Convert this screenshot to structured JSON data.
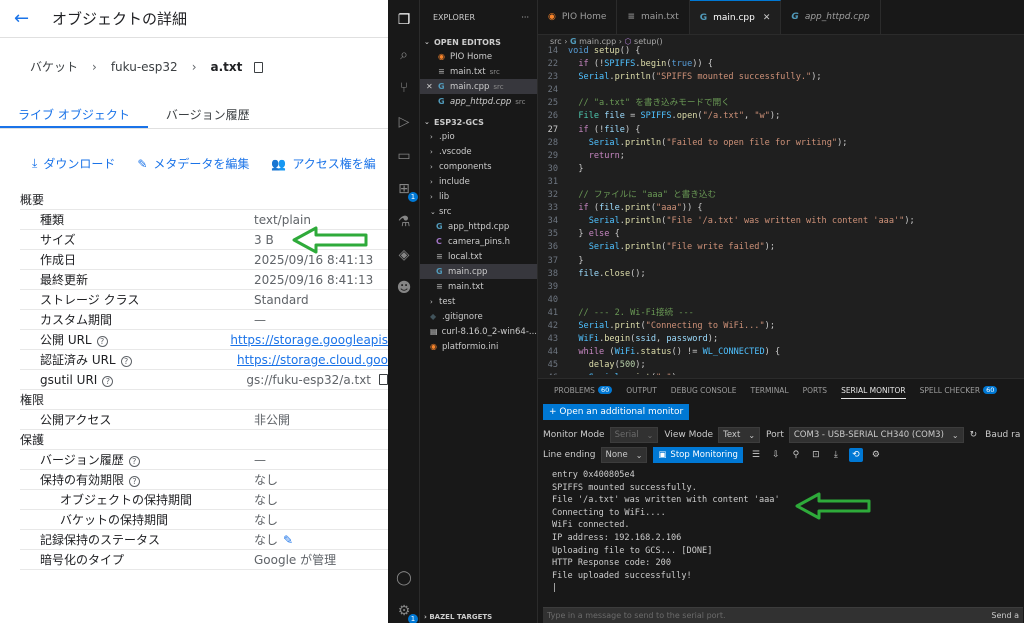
{
  "gcs": {
    "title": "オブジェクトの詳細",
    "breadcrumb": {
      "root": "バケット",
      "bucket": "fuku-esp32",
      "object": "a.txt"
    },
    "tabs": [
      {
        "label": "ライブ オブジェクト"
      },
      {
        "label": "バージョン履歴"
      }
    ],
    "actions": {
      "download": "ダウンロード",
      "edit_metadata": "メタデータを編集",
      "access": "アクセス権を編"
    },
    "sections": {
      "overview": "概要",
      "permissions": "権限",
      "protection": "保護"
    },
    "fields": {
      "type": {
        "k": "種類",
        "v": "text/plain"
      },
      "size": {
        "k": "サイズ",
        "v": "3 B"
      },
      "created": {
        "k": "作成日",
        "v": "2025/09/16 8:41:13"
      },
      "updated": {
        "k": "最終更新",
        "v": "2025/09/16 8:41:13"
      },
      "storage_class": {
        "k": "ストレージ クラス",
        "v": "Standard"
      },
      "custom_time": {
        "k": "カスタム期間",
        "v": "—"
      },
      "public_url": {
        "k": "公開 URL",
        "v": "https://storage.googleapis"
      },
      "auth_url": {
        "k": "認証済み URL",
        "v": "https://storage.cloud.goo"
      },
      "gsutil_uri": {
        "k": "gsutil URI",
        "v": "gs://fuku-esp32/a.txt"
      },
      "public_access": {
        "k": "公開アクセス",
        "v": "非公開"
      },
      "version_history": {
        "k": "バージョン履歴",
        "v": "—"
      },
      "retention": {
        "k": "保持の有効期限",
        "v": "なし"
      },
      "object_retention": {
        "k": "オブジェクトの保持期間",
        "v": "なし"
      },
      "bucket_retention": {
        "k": "バケットの保持期間",
        "v": "なし"
      },
      "hold_status": {
        "k": "記録保持のステータス",
        "v": "なし"
      },
      "encryption": {
        "k": "暗号化のタイプ",
        "v": "Google が管理"
      }
    }
  },
  "vscode": {
    "activity_badge": "1",
    "explorer": {
      "title": "EXPLORER",
      "more": "···",
      "open_editors_title": "OPEN EDITORS",
      "open_editors": [
        {
          "name": "PIO Home",
          "icon": "pio",
          "tag": ""
        },
        {
          "name": "main.txt",
          "icon": "txt",
          "tag": "src"
        },
        {
          "name": "main.cpp",
          "icon": "cpp",
          "tag": "src"
        },
        {
          "name": "app_httpd.cpp",
          "icon": "cpp",
          "tag": "src"
        }
      ],
      "project_title": "ESP32-GCS",
      "tree": [
        {
          "name": ".pio",
          "kind": "folder"
        },
        {
          "name": ".vscode",
          "kind": "folder"
        },
        {
          "name": "components",
          "kind": "folder"
        },
        {
          "name": "include",
          "kind": "folder"
        },
        {
          "name": "lib",
          "kind": "folder"
        },
        {
          "name": "src",
          "kind": "folder-open"
        },
        {
          "name": "app_httpd.cpp",
          "kind": "cpp"
        },
        {
          "name": "camera_pins.h",
          "kind": "h"
        },
        {
          "name": "local.txt",
          "kind": "txt"
        },
        {
          "name": "main.cpp",
          "kind": "cpp"
        },
        {
          "name": "main.txt",
          "kind": "txt"
        },
        {
          "name": "test",
          "kind": "folder"
        },
        {
          "name": ".gitignore",
          "kind": "git"
        },
        {
          "name": "curl-8.16.0_2-win64-...",
          "kind": "zip"
        },
        {
          "name": "platformio.ini",
          "kind": "pio"
        }
      ],
      "bazel": "BAZEL TARGETS"
    },
    "tabs": [
      {
        "name": "PIO Home",
        "icon": "pio"
      },
      {
        "name": "main.txt",
        "icon": "txt"
      },
      {
        "name": "main.cpp",
        "icon": "cpp"
      },
      {
        "name": "app_httpd.cpp",
        "icon": "cpp"
      }
    ],
    "breadcrumb": {
      "folder": "src",
      "file": "main.cpp",
      "symbol": "setup()"
    },
    "panel": {
      "tabs": [
        {
          "label": "PROBLEMS",
          "badge": "60"
        },
        {
          "label": "OUTPUT",
          "badge": ""
        },
        {
          "label": "DEBUG CONSOLE",
          "badge": ""
        },
        {
          "label": "TERMINAL",
          "badge": ""
        },
        {
          "label": "PORTS",
          "badge": ""
        },
        {
          "label": "SERIAL MONITOR",
          "badge": ""
        },
        {
          "label": "SPELL CHECKER",
          "badge": "60"
        }
      ],
      "add_monitor": "+ Open an additional monitor",
      "monitor_mode_label": "Monitor Mode",
      "monitor_mode_value": "Serial",
      "view_mode_label": "View Mode",
      "view_mode_value": "Text",
      "port_label": "Port",
      "port_value": "COM3 - USB-SERIAL CH340 (COM3)",
      "baud_label": "Baud ra",
      "line_ending_label": "Line ending",
      "line_ending_value": "None",
      "stop_button": "Stop Monitoring",
      "output_lines": [
        "entry 0x400805e4",
        "SPIFFS mounted successfully.",
        "File '/a.txt' was written with content 'aaa'",
        "Connecting to WiFi....",
        "WiFi connected.",
        "IP address: 192.168.2.106",
        "Uploading file to GCS... [DONE]",
        "HTTP Response code: 200",
        "File uploaded successfully!"
      ],
      "input_placeholder": "Type in a message to send to the serial port.",
      "send_label": "Send a"
    }
  }
}
